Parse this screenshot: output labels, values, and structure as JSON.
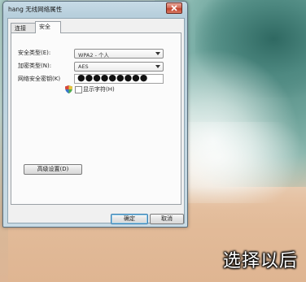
{
  "window": {
    "title": "hang 无线网络属性"
  },
  "tabs": [
    {
      "label": "连接"
    },
    {
      "label": "安全"
    }
  ],
  "security": {
    "security_type_label": "安全类型(E):",
    "security_type_value": "WPA2 - 个人",
    "encryption_type_label": "加密类型(N):",
    "encryption_type_value": "AES",
    "network_key_label": "网络安全密钥(K)",
    "network_key_value": "●●●●●●●●●",
    "show_chars_label": "显示字符(H)",
    "show_chars_checked": false,
    "advanced_label": "高级设置(D)"
  },
  "buttons": {
    "ok_label": "确定",
    "cancel_label": "取消"
  },
  "caption": "选择以后"
}
